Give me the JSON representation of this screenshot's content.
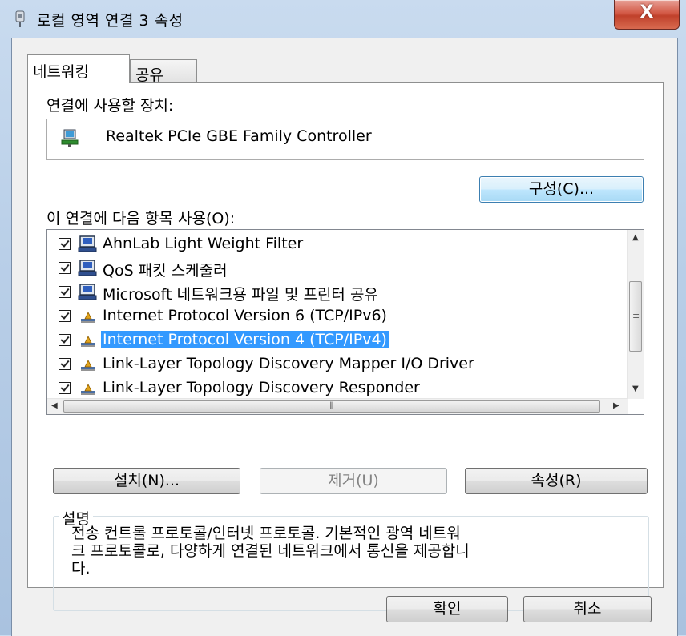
{
  "window": {
    "title": "로컬 영역 연결 3 속성",
    "close_label": "X"
  },
  "tabs": [
    {
      "label": "네트워킹",
      "selected": true
    },
    {
      "label": "공유",
      "selected": false
    }
  ],
  "connect_using": {
    "label": "연결에 사용할 장치:",
    "device_name": "Realtek PCIe GBE Family Controller",
    "configure_label": "구성(C)..."
  },
  "items_section": {
    "label": "이 연결에 다음 항목 사용(O):",
    "items": [
      {
        "label": "AhnLab Light Weight Filter",
        "checked": true,
        "icon": "network-client-icon",
        "selected": false
      },
      {
        "label": "QoS 패킷 스케줄러",
        "checked": true,
        "icon": "network-client-icon",
        "selected": false
      },
      {
        "label": "Microsoft 네트워크용 파일 및 프린터 공유",
        "checked": true,
        "icon": "network-client-icon",
        "selected": false
      },
      {
        "label": "Internet Protocol Version 6 (TCP/IPv6)",
        "checked": true,
        "icon": "protocol-icon",
        "selected": false
      },
      {
        "label": "Internet Protocol Version 4 (TCP/IPv4)",
        "checked": true,
        "icon": "protocol-icon",
        "selected": true
      },
      {
        "label": "Link-Layer Topology Discovery Mapper I/O Driver",
        "checked": true,
        "icon": "protocol-icon",
        "selected": false
      },
      {
        "label": "Link-Layer Topology Discovery Responder",
        "checked": true,
        "icon": "protocol-icon",
        "selected": false
      }
    ]
  },
  "buttons": {
    "install": "설치(N)...",
    "uninstall": "제거(U)",
    "properties": "속성(R)",
    "ok": "확인",
    "cancel": "취소"
  },
  "description": {
    "legend": "설명",
    "lines": [
      "전송 컨트롤 프로토콜/인터넷 프로토콜. 기본적인 광역 네트워",
      "크 프로토콜로, 다양하게 연결된 네트워크에서 통신을 제공합니",
      "다."
    ]
  },
  "colors": {
    "selection": "#3399ff",
    "close_button": "#c0412b"
  }
}
